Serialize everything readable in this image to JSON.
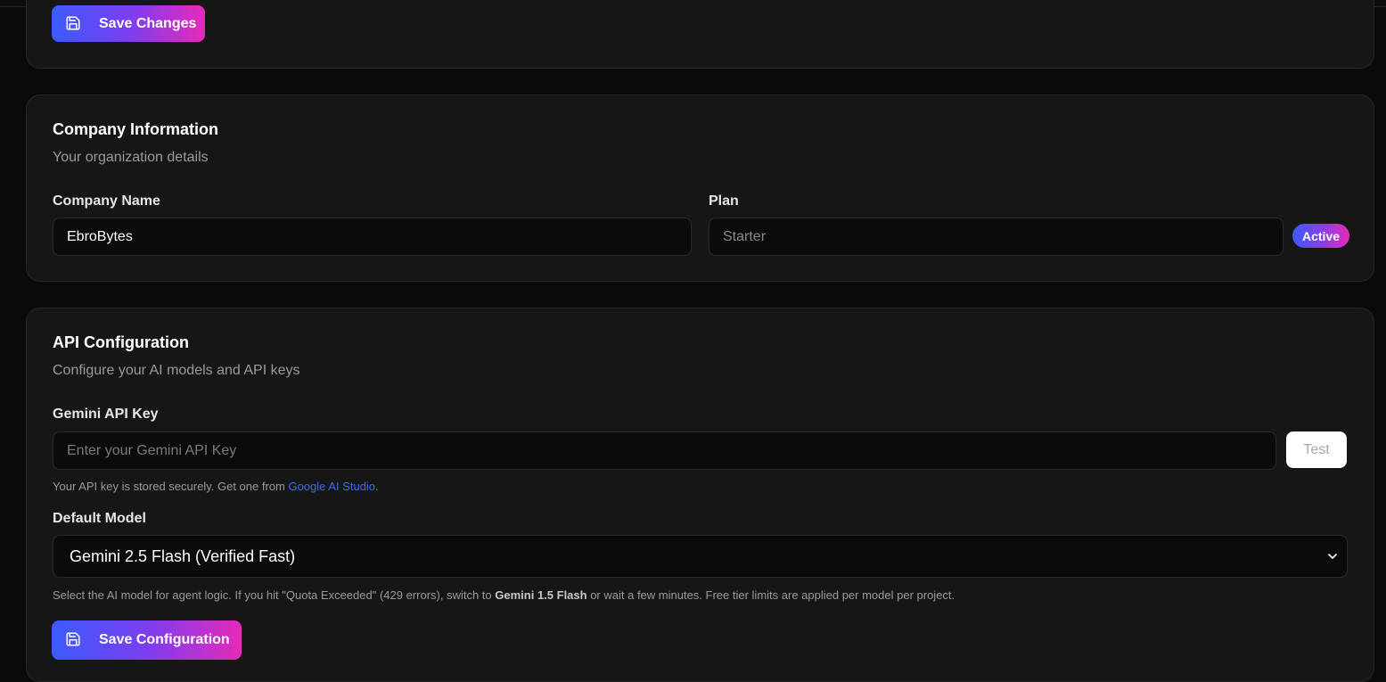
{
  "profile": {
    "save_label": "Save Changes"
  },
  "company": {
    "title": "Company Information",
    "subtitle": "Your organization details",
    "name_label": "Company Name",
    "name_value": "EbroBytes",
    "plan_label": "Plan",
    "plan_value": "Starter",
    "plan_badge": "Active"
  },
  "api": {
    "title": "API Configuration",
    "subtitle": "Configure your AI models and API keys",
    "key_label": "Gemini API Key",
    "key_placeholder": "Enter your Gemini API Key",
    "key_value": "",
    "test_label": "Test",
    "key_help_prefix": "Your API key is stored securely. Get one from ",
    "key_help_link": "Google AI Studio",
    "key_help_suffix": ".",
    "model_label": "Default Model",
    "model_selected": "Gemini 2.5 Flash (Verified Fast)",
    "model_help_prefix": "Select the AI model for agent logic. If you hit \"Quota Exceeded\" (429 errors), switch to ",
    "model_help_bold": "Gemini 1.5 Flash",
    "model_help_suffix": " or wait a few minutes. Free tier limits are applied per model per project.",
    "save_label": "Save Configuration"
  },
  "colors": {
    "background": "#0a0a0a",
    "card": "#161616",
    "accent_start": "#3b5bfd",
    "accent_end": "#e62ab8",
    "link": "#3b6df6"
  },
  "icons": [
    "save-icon",
    "chevron-down-icon"
  ]
}
